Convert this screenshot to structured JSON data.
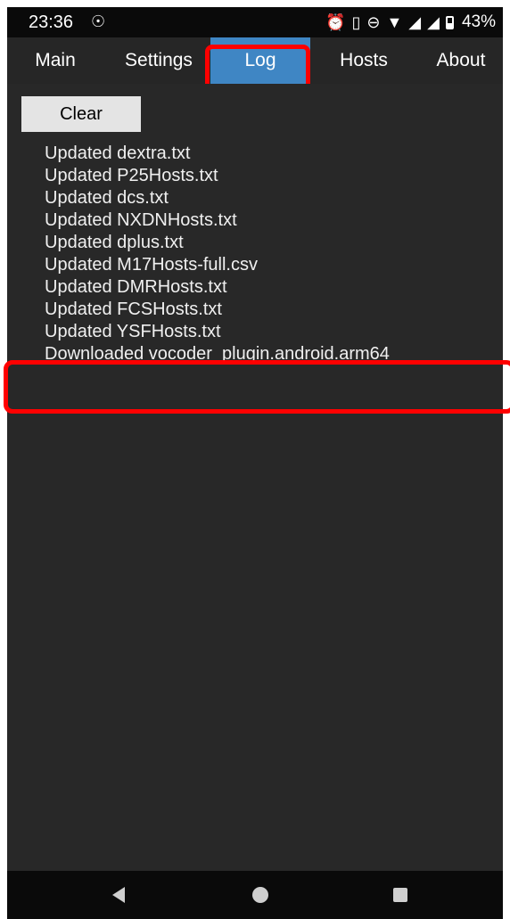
{
  "status_bar": {
    "time": "23:36",
    "left_icon": "data-saver-icon",
    "right_icons": [
      "alarm-icon",
      "vibrate-icon",
      "do-not-disturb-icon",
      "wifi-icon",
      "signal-icon",
      "signal-icon",
      "battery-icon"
    ],
    "battery": "43%"
  },
  "tabs": [
    {
      "label": "Main"
    },
    {
      "label": "Settings"
    },
    {
      "label": "Log",
      "selected": true
    },
    {
      "label": "Hosts"
    },
    {
      "label": "About"
    }
  ],
  "log": {
    "clear_label": "Clear",
    "lines": [
      "Updated dextra.txt",
      "Updated P25Hosts.txt",
      "Updated dcs.txt",
      "Updated NXDNHosts.txt",
      "Updated dplus.txt",
      "Updated M17Hosts-full.csv",
      "Updated DMRHosts.txt",
      "Updated FCSHosts.txt",
      "Updated YSFHosts.txt",
      "Downloaded vocoder_plugin.android.arm64"
    ]
  },
  "nav_bar": {
    "back": "back-icon",
    "home": "home-icon",
    "recents": "recents-icon"
  },
  "colors": {
    "selected_tab": "#3f86c4",
    "tab_bar": "#262626",
    "content_bg": "#282828",
    "annotation": "#ff0000"
  }
}
